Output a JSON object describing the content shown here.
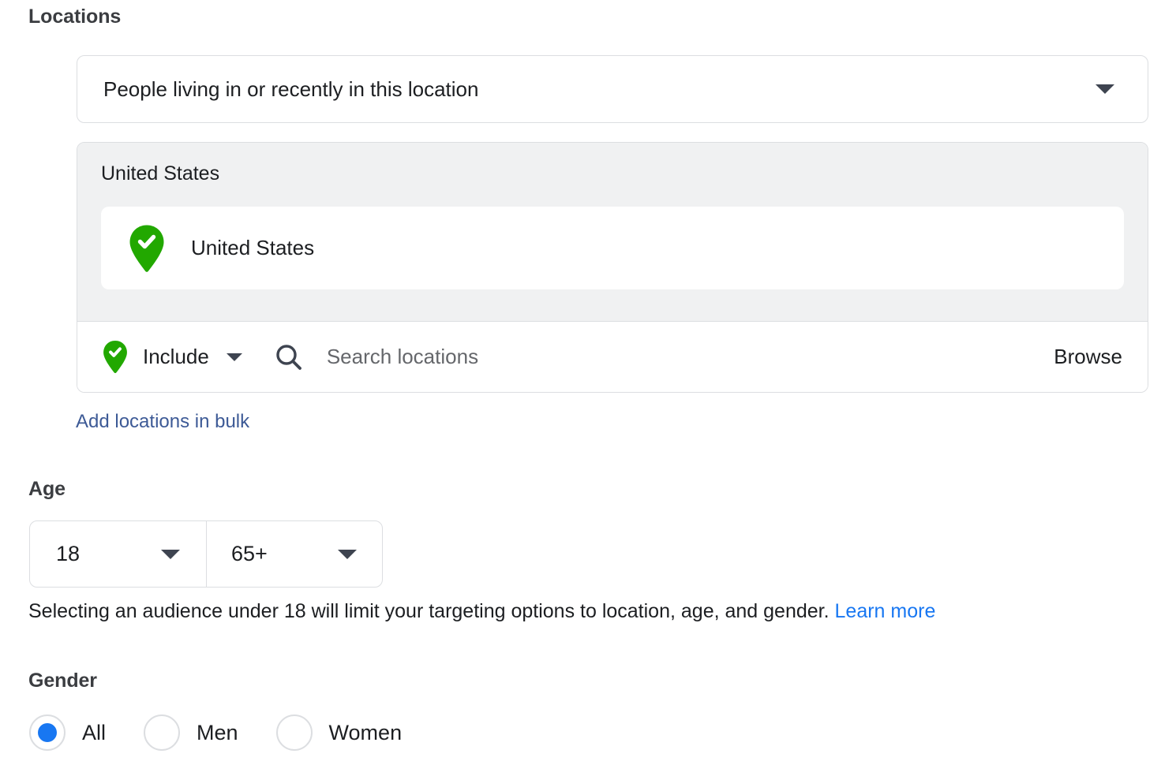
{
  "locations": {
    "title": "Locations",
    "location_type": {
      "value": "People living in or recently in this location",
      "caret_icon": "chevron-down-icon"
    },
    "selected_group_label": "United States",
    "selected_items": [
      {
        "name": "United States",
        "icon": "green-map-pin-check-icon"
      }
    ],
    "include_row": {
      "mode_label": "Include",
      "mode_icon": "green-map-pin-check-icon",
      "mode_caret_icon": "chevron-down-icon",
      "search_icon": "search-icon",
      "search_value": "",
      "search_placeholder": "Search locations",
      "browse_label": "Browse"
    },
    "bulk_link_label": "Add locations in bulk"
  },
  "age": {
    "title": "Age",
    "min_value": "18",
    "max_value": "65+",
    "note_text": "Selecting an audience under 18 will limit your targeting options to location, age, and gender.",
    "note_link_label": "Learn more"
  },
  "gender": {
    "title": "Gender",
    "options": [
      {
        "label": "All",
        "selected": true
      },
      {
        "label": "Men",
        "selected": false
      },
      {
        "label": "Women",
        "selected": false
      }
    ]
  },
  "colors": {
    "link_blue": "#1877f2",
    "bulk_link_blue": "#3d5a96",
    "pin_green": "#22a800",
    "panel_gray": "#f0f1f2",
    "border_gray": "#dcdee1",
    "text_dark": "#1c1e21",
    "placeholder_gray": "#65676b"
  }
}
